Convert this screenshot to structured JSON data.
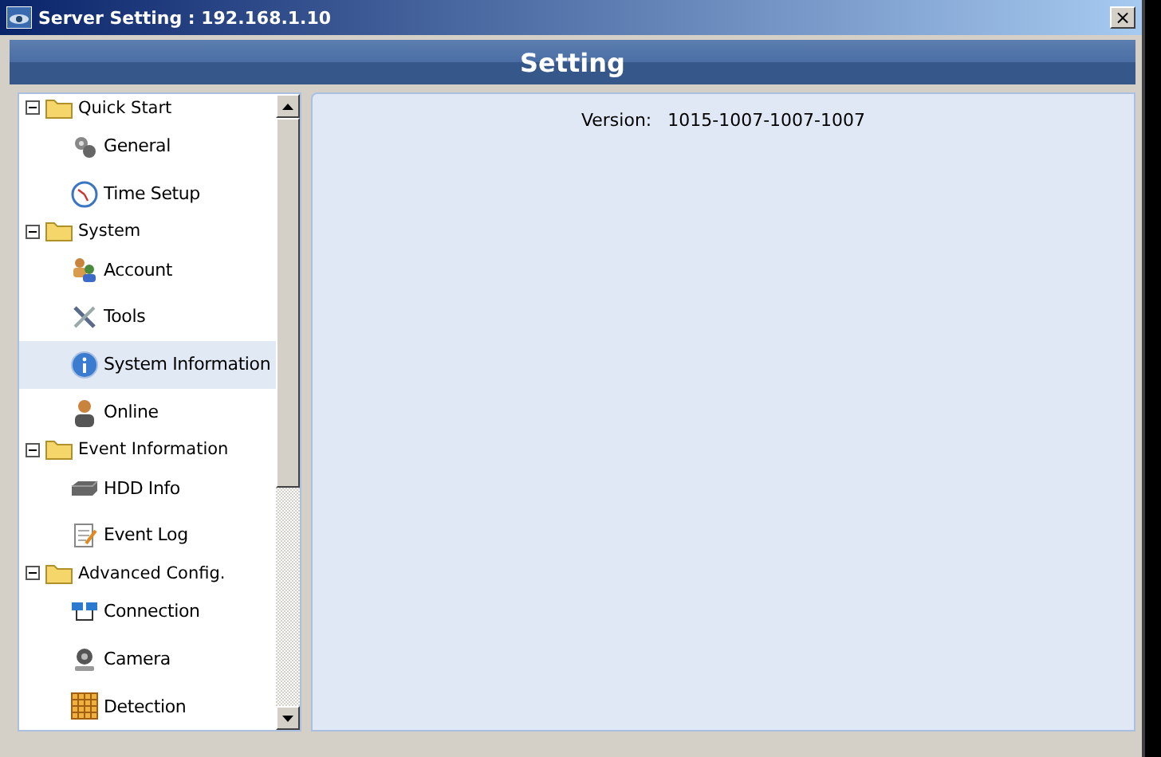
{
  "window": {
    "title": "Server Setting : 192.168.1.10",
    "close": "×"
  },
  "header": {
    "title": "Setting"
  },
  "tree": [
    {
      "label": "Quick Start",
      "expanded": true,
      "children": [
        {
          "label": "General",
          "selected": false
        },
        {
          "label": "Time Setup",
          "selected": false
        }
      ]
    },
    {
      "label": "System",
      "expanded": true,
      "children": [
        {
          "label": "Account",
          "selected": false
        },
        {
          "label": "Tools",
          "selected": false
        },
        {
          "label": "System Information",
          "selected": true
        },
        {
          "label": "Online",
          "selected": false
        }
      ]
    },
    {
      "label": "Event Information",
      "expanded": true,
      "children": [
        {
          "label": "HDD Info",
          "selected": false
        },
        {
          "label": "Event Log",
          "selected": false
        }
      ]
    },
    {
      "label": "Advanced Config.",
      "expanded": true,
      "children": [
        {
          "label": "Connection",
          "selected": false
        },
        {
          "label": "Camera",
          "selected": false
        },
        {
          "label": "Detection",
          "selected": false
        }
      ]
    }
  ],
  "content": {
    "version_label": "Version:",
    "version_value": "1015-1007-1007-1007"
  }
}
